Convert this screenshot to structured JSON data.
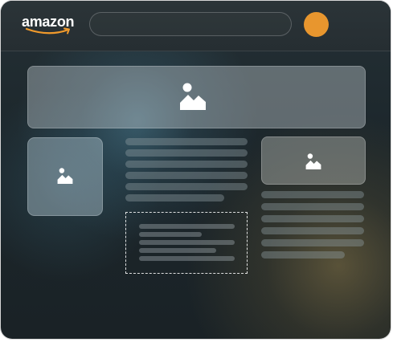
{
  "header": {
    "logo_text": "amazon",
    "logo_icon": "amazon-smile-logo",
    "search": {
      "value": "",
      "placeholder": ""
    },
    "avatar": {
      "color": "#e8962e"
    }
  },
  "colors": {
    "background": "#1c262b",
    "accent": "#e8962e",
    "placeholder_card": "#a8b4b8",
    "skeleton_line": "#5f6c70"
  },
  "content": {
    "hero_image": {
      "icon": "image-placeholder-icon"
    },
    "left_image": {
      "icon": "image-placeholder-icon"
    },
    "right_image": {
      "icon": "image-placeholder-icon"
    },
    "center_text_lines": 6,
    "right_text_lines": 6,
    "selected_block_lines": 5,
    "selected_block_style": "dashed-outline"
  }
}
